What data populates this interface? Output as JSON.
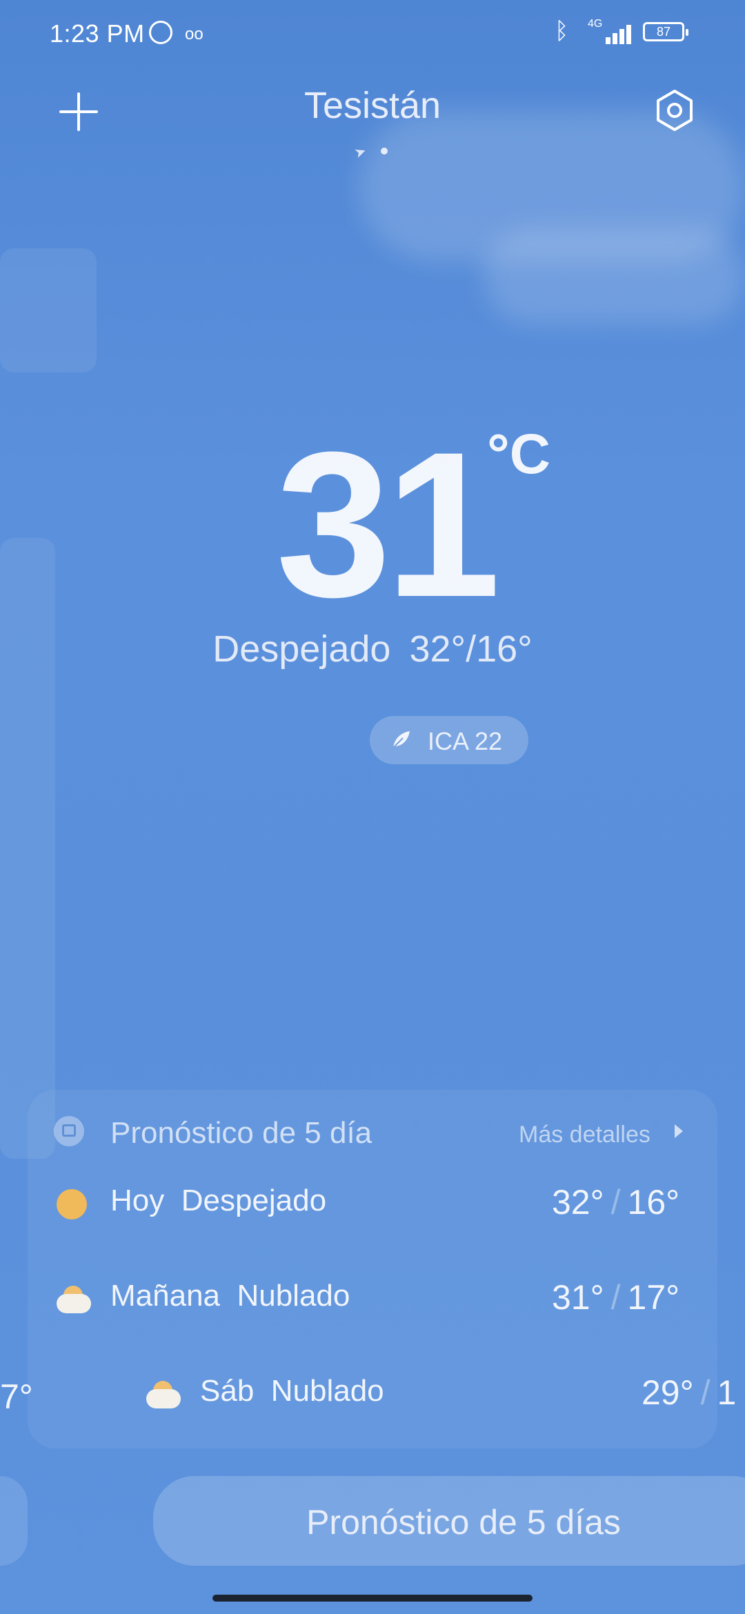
{
  "status_bar": {
    "time": "1:23 PM",
    "network_label": "4G",
    "battery": "87"
  },
  "header": {
    "city": "Tesistán"
  },
  "current": {
    "temperature": "31",
    "unit": "°C",
    "condition": "Despejado",
    "high_low": "32°/16°",
    "aqi": "ICA 22"
  },
  "forecast": {
    "title": "Pronóstico de 5 día",
    "more_details": "Más detalles",
    "rows": [
      {
        "day": "Hoy",
        "condition": "Despejado",
        "high": "32°",
        "low": "16°",
        "icon": "sun-icon"
      },
      {
        "day": "Mañana",
        "condition": "Nublado",
        "high": "31°",
        "low": "17°",
        "icon": "partly-cloudy-icon"
      },
      {
        "day": "Sáb",
        "condition": "Nublado",
        "high": "29°",
        "low": "1",
        "icon": "partly-cloudy-icon"
      }
    ],
    "left_partial": "7°"
  },
  "bottom_button": {
    "label": "Pronóstico de 5 días"
  },
  "colors": {
    "background": "#5a90db",
    "sun": "#f0b95a"
  }
}
